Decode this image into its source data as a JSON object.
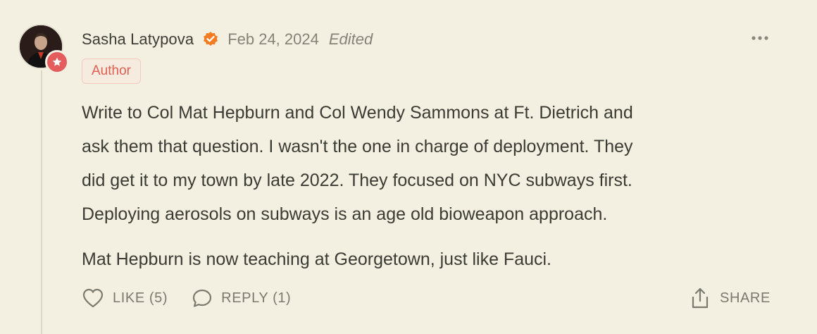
{
  "comment": {
    "author": {
      "name": "Sasha Latypova",
      "badge_label": "Author"
    },
    "date": "Feb 24, 2024",
    "edited_label": "Edited",
    "paragraphs": [
      [
        "Write to Col Mat Hepburn and Col Wendy Sammons at Ft. Dietrich and",
        "ask them that question. I wasn't the one in charge of deployment. They",
        "did get it to my town by late 2022. They focused on NYC subways first.",
        "Deploying aerosols on subways is an age old bioweapon approach."
      ],
      [
        "Mat Hepburn is now teaching at Georgetown, just like Fauci."
      ]
    ]
  },
  "actions": {
    "like": {
      "label": "LIKE (5)",
      "icon": "heart-icon"
    },
    "reply": {
      "label": "REPLY (1)",
      "icon": "speech-bubble-icon"
    },
    "share": {
      "label": "SHARE",
      "icon": "share-icon"
    },
    "more_icon": "more-dots-icon"
  },
  "colors": {
    "background": "#f3f0e2",
    "accent_orange": "#f27c22",
    "author_red": "#e35d5d",
    "muted_text": "#858375"
  }
}
